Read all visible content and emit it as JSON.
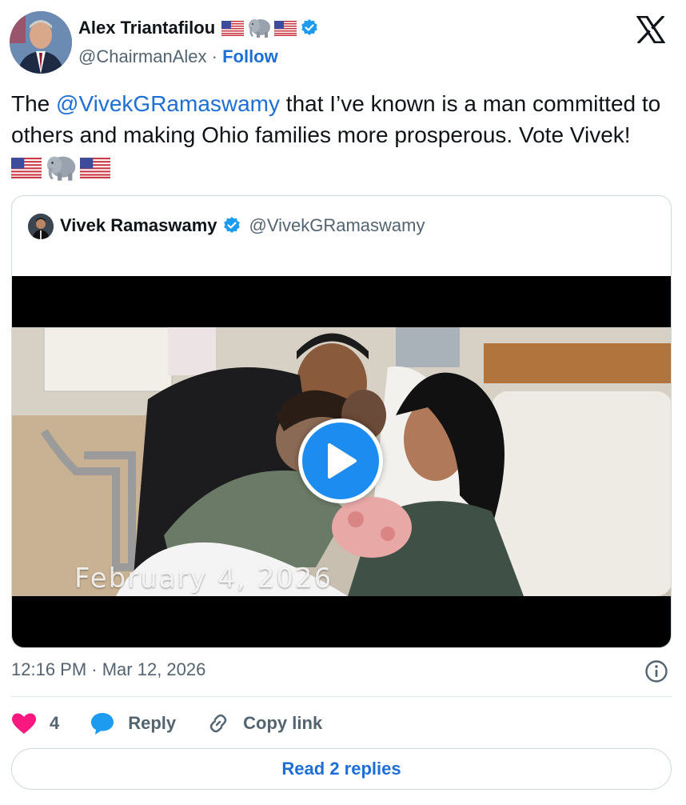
{
  "author": {
    "name": "Alex Triantafilou",
    "handle": "@ChairmanAlex",
    "separator": "·",
    "follow_label": "Follow"
  },
  "tweet": {
    "text_before": "The ",
    "mention": "@VivekGRamaswamy",
    "text_after": " that I’ve known is a man committed to others and making Ohio families more prosperous. Vote Vivek! "
  },
  "quoted": {
    "name": "Vivek Ramaswamy",
    "handle": "@VivekGRamaswamy",
    "video_date_overlay": "February 4, 2026"
  },
  "meta": {
    "timestamp": "12:16 PM · Mar 12, 2026"
  },
  "actions": {
    "like_count": "4",
    "reply_label": "Reply",
    "copy_link_label": "Copy link"
  },
  "read_replies_label": "Read 2 replies",
  "colors": {
    "link_blue": "#1d6fd6",
    "verified_blue": "#1d9bf0",
    "like_red": "#f91880",
    "text": "#0f1419",
    "muted": "#536471"
  },
  "icons": [
    "us-flag-icon",
    "elephant-icon",
    "verified-badge-icon",
    "x-logo-icon",
    "play-icon",
    "info-icon",
    "heart-icon",
    "reply-bubble-icon",
    "link-icon"
  ]
}
